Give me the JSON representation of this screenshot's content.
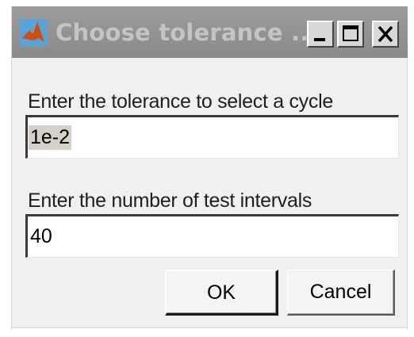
{
  "window": {
    "title": "Choose tolerance ...",
    "app_icon": "matlab-icon",
    "controls": [
      "minimize-icon",
      "maximize-icon",
      "close-icon"
    ]
  },
  "form": {
    "tolerance_label": "Enter the tolerance to select a cycle",
    "tolerance_value": "1e-2",
    "intervals_label": "Enter the number of test intervals",
    "intervals_value": "40"
  },
  "buttons": {
    "ok": "OK",
    "cancel": "Cancel"
  },
  "colors": {
    "titlebar": "#8f8f8f",
    "title_text": "#c4c4c4",
    "dialog_bg": "#f0f0f0",
    "selection": "#d6d0c8"
  }
}
